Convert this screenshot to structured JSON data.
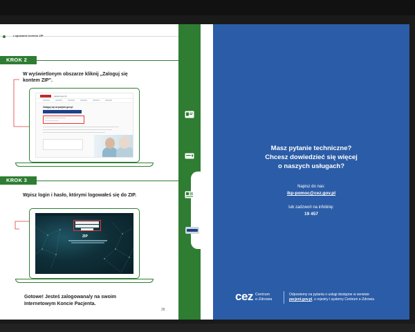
{
  "header": {
    "section_title": "Logowanie kontem ZIP"
  },
  "steps": [
    {
      "badge": "KROK 2",
      "instruction_line1": "W wyświetlonym obszarze kliknij „Zaloguj się",
      "instruction_line2": "kontem ZIP\"."
    },
    {
      "badge": "KROK 3",
      "instruction_line1": "Wpisz login i hasło, którymi logowałeś się do ZIP."
    }
  ],
  "screen1": {
    "url": "pacjent.gov.pl",
    "heading": "Zaloguj się na pacjent.gov.pl"
  },
  "screen2": {
    "logo": "ZIP"
  },
  "closing": {
    "line1": "Gotowe! Jesteś zalogowana/y na swoim",
    "line2": "Internetowym Koncie Pacjenta."
  },
  "page_number": "26",
  "right": {
    "title_line1": "Masz pytanie techniczne?",
    "title_line2": "Chcesz dowiedzieć się więcej",
    "title_line3": "o naszych usługach?",
    "write_label": "Napisz do nas:",
    "email": "ikp-pomoc@cez.gov.pl",
    "call_label": "lub zadzwoń na infolinię:",
    "phone": "19 457",
    "logo_mark": "cez",
    "logo_text_line1": "Centrum",
    "logo_text_line2": "e-Zdrowia",
    "footer_line1": "Odpowiemy na pytania o usługi dostępne w serwisie",
    "footer_link": "pacjent.gov.pl",
    "footer_line2": ", o rejestry i systemy Centrum e-Zdrowia"
  },
  "colors": {
    "green": "#2e7d32",
    "blue": "#2b5ca7",
    "red": "#e53935"
  },
  "icons": [
    "id-card-icon",
    "card-icon",
    "document-icon",
    "chip-icon"
  ]
}
